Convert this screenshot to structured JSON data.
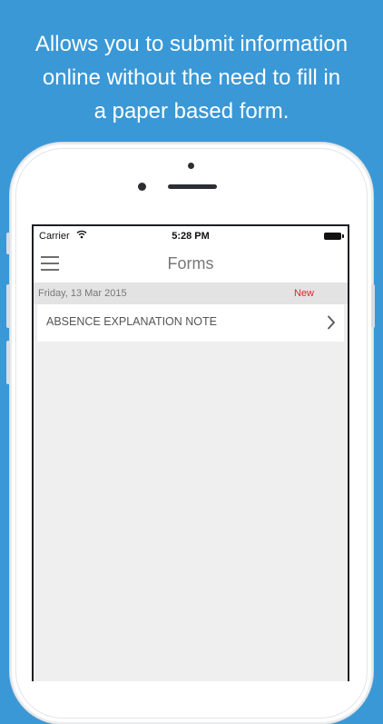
{
  "headline": {
    "line1": "Allows you to submit information",
    "line2": "online without the need to fill in",
    "line3": "a paper based form."
  },
  "status_bar": {
    "carrier": "Carrier",
    "time": "5:28 PM"
  },
  "navbar": {
    "title": "Forms"
  },
  "section": {
    "date": "Friday, 13 Mar 2015",
    "badge": "New"
  },
  "forms": [
    {
      "label": "ABSENCE EXPLANATION NOTE"
    }
  ],
  "colors": {
    "background": "#3a98d6",
    "badge": "#e0262b"
  },
  "icons": {
    "menu": "hamburger-menu-icon",
    "row": "chevron-right-icon"
  }
}
